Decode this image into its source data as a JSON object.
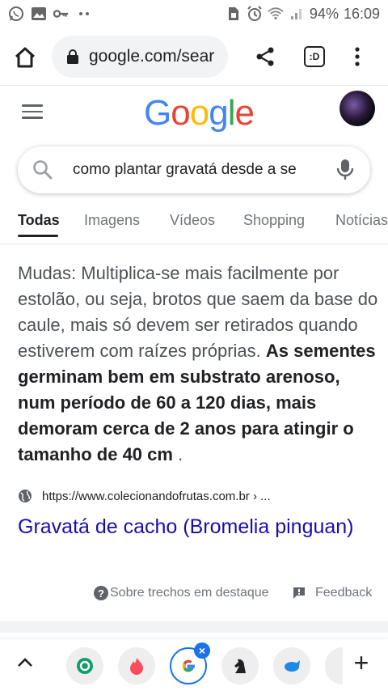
{
  "status_bar": {
    "battery": "94%",
    "time": "16:09",
    "left_icons": [
      "whatsapp-icon",
      "gallery-icon",
      "key-icon",
      "more-dots-icon"
    ],
    "right_icons": [
      "sim-icon",
      "alarm-icon",
      "wifi-icon",
      "signal-icon"
    ]
  },
  "browser": {
    "url": "google.com/sear",
    "buttons": [
      "home",
      "share",
      "tab-switcher",
      "menu"
    ],
    "tab_switcher_label": ":D"
  },
  "google": {
    "logo": [
      "G",
      "o",
      "o",
      "g",
      "l",
      "e"
    ],
    "logo_colors": [
      "#4285F4",
      "#EA4335",
      "#FBBC05",
      "#4285F4",
      "#34A853",
      "#EA4335"
    ],
    "query": "como plantar gravatá desde a se",
    "tabs": [
      "Todas",
      "Imagens",
      "Vídeos",
      "Shopping",
      "Notícias"
    ],
    "active_tab": "Todas"
  },
  "snippet": {
    "plain": "Mudas: Multiplica-se mais facilmente por estolão, ou seja, brotos que saem da base do caule, mais só devem ser retirados quando estiverem com raízes próprias.",
    "bold": "As sementes germinam bem em substrato arenoso, num período de 60 a 120 dias, mais demoram cerca de 2 anos para atingir o tamanho de 40 cm",
    "tail": ".",
    "source_url": "https://www.colecionandofrutas.com.br › ...",
    "title": "Gravatá de cacho (Bromelia pinguan)",
    "about_label": "Sobre trechos em destaque",
    "feedback_label": "Feedback"
  },
  "tab_strip": {
    "tabs": [
      "tab-green",
      "tab-tinder",
      "tab-google",
      "tab-chess",
      "tab-blue",
      "tab-partial"
    ],
    "active": "tab-google",
    "close_label": "×",
    "add_label": "+"
  },
  "colors": {
    "link": "#1a0dab",
    "accent": "#1a73e8",
    "text": "#202124",
    "muted": "#70757a"
  }
}
